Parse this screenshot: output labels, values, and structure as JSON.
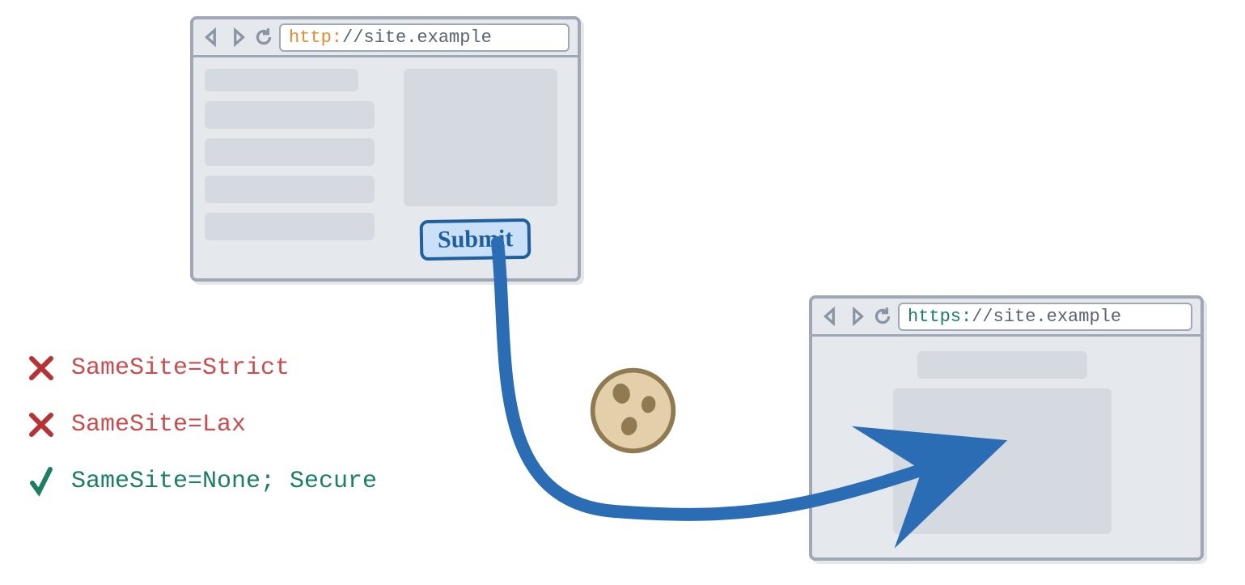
{
  "browser1": {
    "url_scheme": "http:",
    "url_rest": "//site.example",
    "submit_label": "Submit"
  },
  "browser2": {
    "url_scheme": "https:",
    "url_rest": "//site.example"
  },
  "legend": {
    "rows": [
      {
        "status": "deny",
        "text": "SameSite=Strict"
      },
      {
        "status": "deny",
        "text": "SameSite=Lax"
      },
      {
        "status": "allow",
        "text": "SameSite=None; Secure"
      }
    ]
  },
  "icons": {
    "cookie": "cookie-icon",
    "back": "back-icon",
    "forward": "forward-icon",
    "reload": "reload-icon",
    "cross": "cross-icon",
    "check": "check-icon"
  }
}
